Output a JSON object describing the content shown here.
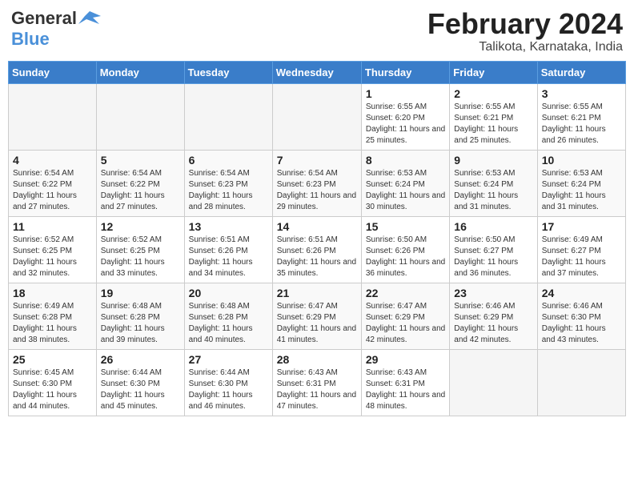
{
  "logo": {
    "general": "General",
    "blue": "Blue"
  },
  "title": "February 2024",
  "subtitle": "Talikota, Karnataka, India",
  "days_of_week": [
    "Sunday",
    "Monday",
    "Tuesday",
    "Wednesday",
    "Thursday",
    "Friday",
    "Saturday"
  ],
  "weeks": [
    [
      {
        "day": "",
        "info": ""
      },
      {
        "day": "",
        "info": ""
      },
      {
        "day": "",
        "info": ""
      },
      {
        "day": "",
        "info": ""
      },
      {
        "day": "1",
        "info": "Sunrise: 6:55 AM\nSunset: 6:20 PM\nDaylight: 11 hours and 25 minutes."
      },
      {
        "day": "2",
        "info": "Sunrise: 6:55 AM\nSunset: 6:21 PM\nDaylight: 11 hours and 25 minutes."
      },
      {
        "day": "3",
        "info": "Sunrise: 6:55 AM\nSunset: 6:21 PM\nDaylight: 11 hours and 26 minutes."
      }
    ],
    [
      {
        "day": "4",
        "info": "Sunrise: 6:54 AM\nSunset: 6:22 PM\nDaylight: 11 hours and 27 minutes."
      },
      {
        "day": "5",
        "info": "Sunrise: 6:54 AM\nSunset: 6:22 PM\nDaylight: 11 hours and 27 minutes."
      },
      {
        "day": "6",
        "info": "Sunrise: 6:54 AM\nSunset: 6:23 PM\nDaylight: 11 hours and 28 minutes."
      },
      {
        "day": "7",
        "info": "Sunrise: 6:54 AM\nSunset: 6:23 PM\nDaylight: 11 hours and 29 minutes."
      },
      {
        "day": "8",
        "info": "Sunrise: 6:53 AM\nSunset: 6:24 PM\nDaylight: 11 hours and 30 minutes."
      },
      {
        "day": "9",
        "info": "Sunrise: 6:53 AM\nSunset: 6:24 PM\nDaylight: 11 hours and 31 minutes."
      },
      {
        "day": "10",
        "info": "Sunrise: 6:53 AM\nSunset: 6:24 PM\nDaylight: 11 hours and 31 minutes."
      }
    ],
    [
      {
        "day": "11",
        "info": "Sunrise: 6:52 AM\nSunset: 6:25 PM\nDaylight: 11 hours and 32 minutes."
      },
      {
        "day": "12",
        "info": "Sunrise: 6:52 AM\nSunset: 6:25 PM\nDaylight: 11 hours and 33 minutes."
      },
      {
        "day": "13",
        "info": "Sunrise: 6:51 AM\nSunset: 6:26 PM\nDaylight: 11 hours and 34 minutes."
      },
      {
        "day": "14",
        "info": "Sunrise: 6:51 AM\nSunset: 6:26 PM\nDaylight: 11 hours and 35 minutes."
      },
      {
        "day": "15",
        "info": "Sunrise: 6:50 AM\nSunset: 6:26 PM\nDaylight: 11 hours and 36 minutes."
      },
      {
        "day": "16",
        "info": "Sunrise: 6:50 AM\nSunset: 6:27 PM\nDaylight: 11 hours and 36 minutes."
      },
      {
        "day": "17",
        "info": "Sunrise: 6:49 AM\nSunset: 6:27 PM\nDaylight: 11 hours and 37 minutes."
      }
    ],
    [
      {
        "day": "18",
        "info": "Sunrise: 6:49 AM\nSunset: 6:28 PM\nDaylight: 11 hours and 38 minutes."
      },
      {
        "day": "19",
        "info": "Sunrise: 6:48 AM\nSunset: 6:28 PM\nDaylight: 11 hours and 39 minutes."
      },
      {
        "day": "20",
        "info": "Sunrise: 6:48 AM\nSunset: 6:28 PM\nDaylight: 11 hours and 40 minutes."
      },
      {
        "day": "21",
        "info": "Sunrise: 6:47 AM\nSunset: 6:29 PM\nDaylight: 11 hours and 41 minutes."
      },
      {
        "day": "22",
        "info": "Sunrise: 6:47 AM\nSunset: 6:29 PM\nDaylight: 11 hours and 42 minutes."
      },
      {
        "day": "23",
        "info": "Sunrise: 6:46 AM\nSunset: 6:29 PM\nDaylight: 11 hours and 42 minutes."
      },
      {
        "day": "24",
        "info": "Sunrise: 6:46 AM\nSunset: 6:30 PM\nDaylight: 11 hours and 43 minutes."
      }
    ],
    [
      {
        "day": "25",
        "info": "Sunrise: 6:45 AM\nSunset: 6:30 PM\nDaylight: 11 hours and 44 minutes."
      },
      {
        "day": "26",
        "info": "Sunrise: 6:44 AM\nSunset: 6:30 PM\nDaylight: 11 hours and 45 minutes."
      },
      {
        "day": "27",
        "info": "Sunrise: 6:44 AM\nSunset: 6:30 PM\nDaylight: 11 hours and 46 minutes."
      },
      {
        "day": "28",
        "info": "Sunrise: 6:43 AM\nSunset: 6:31 PM\nDaylight: 11 hours and 47 minutes."
      },
      {
        "day": "29",
        "info": "Sunrise: 6:43 AM\nSunset: 6:31 PM\nDaylight: 11 hours and 48 minutes."
      },
      {
        "day": "",
        "info": ""
      },
      {
        "day": "",
        "info": ""
      }
    ]
  ]
}
